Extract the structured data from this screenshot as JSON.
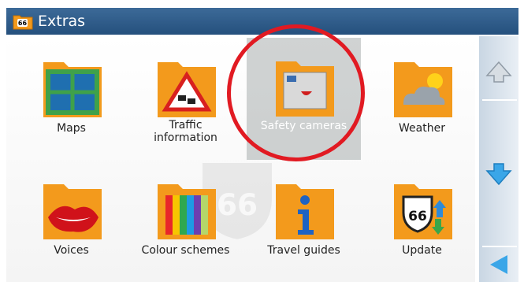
{
  "window": {
    "title": "Extras"
  },
  "items": [
    {
      "label": "Maps",
      "icon": "map-icon"
    },
    {
      "label": "Traffic\ninformation",
      "icon": "traffic-sign-icon"
    },
    {
      "label": "Safety cameras",
      "icon": "speed-camera-icon",
      "selected": true
    },
    {
      "label": "Weather",
      "icon": "weather-cloud-icon"
    },
    {
      "label": "Voices",
      "icon": "lips-icon"
    },
    {
      "label": "Colour schemes",
      "icon": "color-bars-icon"
    },
    {
      "label": "Travel guides",
      "icon": "info-icon"
    },
    {
      "label": "Update",
      "icon": "route66-update-icon"
    }
  ],
  "scrollbar": {
    "up": "arrow-up-icon",
    "down": "arrow-down-icon",
    "back": "arrow-back-icon"
  },
  "colors": {
    "titlebar": "#2e5c8a",
    "folder": "#f39a1c",
    "highlight_circle": "#e11a22",
    "scroll_down_arrow": "#3aa6e8"
  }
}
